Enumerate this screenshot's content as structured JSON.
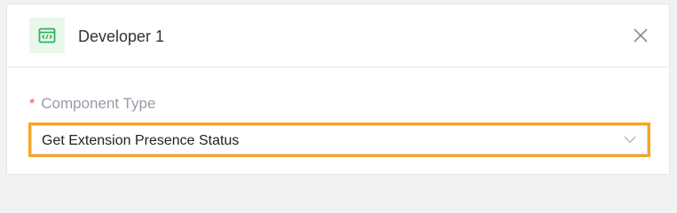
{
  "node": {
    "title": "Developer 1",
    "icon": "code-window-icon",
    "icon_color": "#2fb35a",
    "icon_bg": "#e9f7ed"
  },
  "form": {
    "required_mark": "*",
    "component_type_label": "Component Type",
    "component_type_value": "Get Extension Presence Status"
  },
  "colors": {
    "highlight": "#f5a623",
    "required": "#e34d59"
  }
}
